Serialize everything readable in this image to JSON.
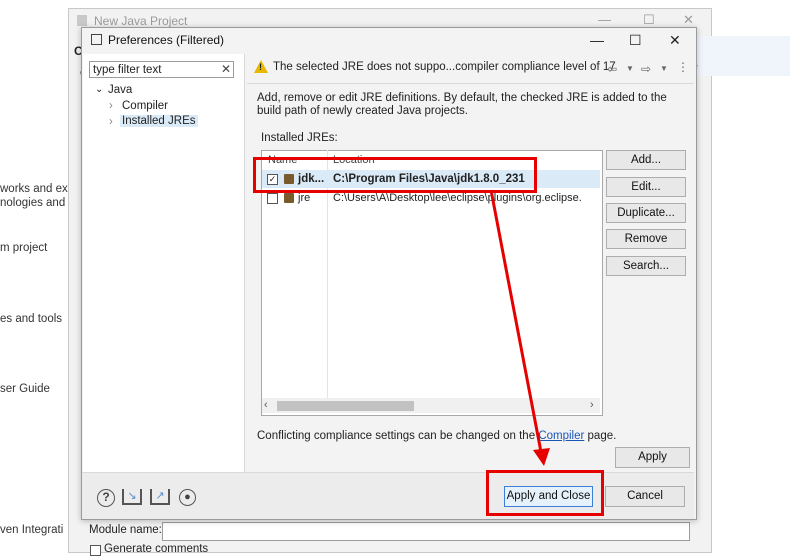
{
  "background": {
    "left_texts": [
      "works and ex",
      "nologies and s",
      "m project",
      "es and tools",
      "ser Guide",
      "ven Integrati"
    ],
    "window_title": "New Java Project",
    "module_label": "Module name:",
    "generate_label": "Generate comments"
  },
  "dialog": {
    "title": "Preferences (Filtered)",
    "filter_text": "type filter text",
    "tree": [
      "Java",
      "Compiler",
      "Installed JREs"
    ],
    "warning": "The selected JRE does not suppo...compiler compliance level of 17",
    "description": "Add, remove or edit JRE definitions. By default, the checked JRE is added to the build path of newly created Java projects.",
    "installed_label": "Installed JREs:",
    "columns": [
      "Name",
      "Location"
    ],
    "rows": [
      {
        "name": "jdk...",
        "location": "C:\\Program Files\\Java\\jdk1.8.0_231",
        "checked": true
      },
      {
        "name": "jre",
        "location": "C:\\Users\\A\\Desktop\\lee\\eclipse\\plugins\\org.eclipse.",
        "checked": false
      }
    ],
    "side_buttons": [
      "Add...",
      "Edit...",
      "Duplicate...",
      "Remove",
      "Search..."
    ],
    "conflict_prefix": "Conflicting compliance settings can be changed on the",
    "conflict_link": "Compiler",
    "conflict_suffix": "page.",
    "apply_label": "Apply",
    "apply_close_label": "Apply and Close",
    "cancel_label": "Cancel"
  },
  "colors": {
    "annotation": "#e60000",
    "selection": "#dbeaf7",
    "link": "#1a56b5",
    "warning": "#e8b800"
  }
}
